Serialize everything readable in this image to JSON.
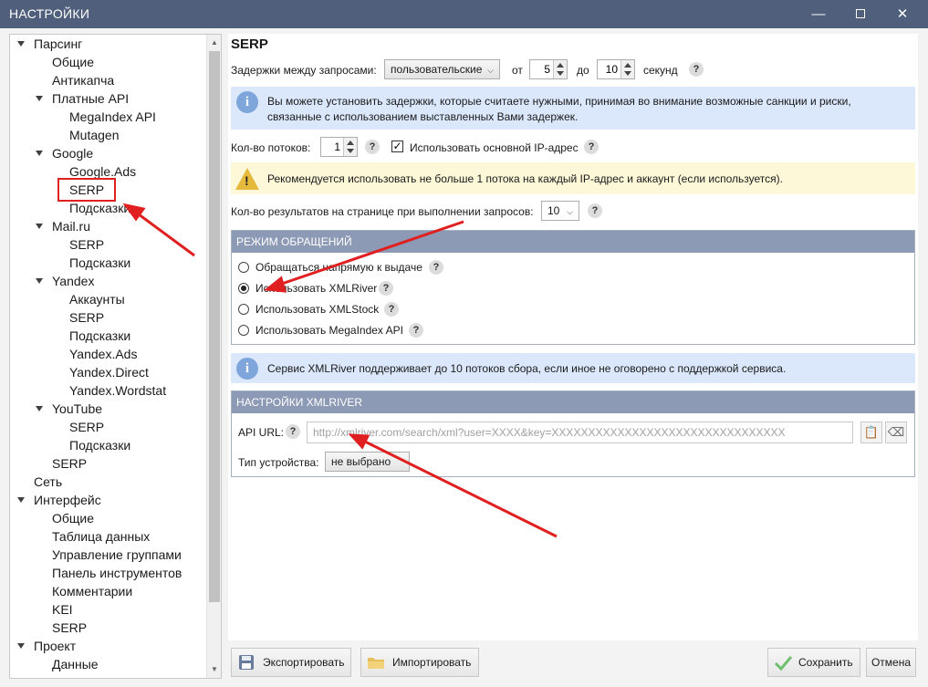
{
  "window": {
    "title": "НАСТРОЙКИ",
    "minimize": "—",
    "close": "✕"
  },
  "tree": {
    "items": [
      {
        "label": "Парсинг",
        "level": 0,
        "expandable": true
      },
      {
        "label": "Общие",
        "level": 1
      },
      {
        "label": "Антикапча",
        "level": 1
      },
      {
        "label": "Платные API",
        "level": 1,
        "expandable": true
      },
      {
        "label": "MegaIndex API",
        "level": 2
      },
      {
        "label": "Mutagen",
        "level": 2
      },
      {
        "label": "Google",
        "level": 1,
        "expandable": true
      },
      {
        "label": "Google.Ads",
        "level": 2
      },
      {
        "label": "SERP",
        "level": 2,
        "selected": true
      },
      {
        "label": "Подсказки",
        "level": 2
      },
      {
        "label": "Mail.ru",
        "level": 1,
        "expandable": true
      },
      {
        "label": "SERP",
        "level": 2
      },
      {
        "label": "Подсказки",
        "level": 2
      },
      {
        "label": "Yandex",
        "level": 1,
        "expandable": true
      },
      {
        "label": "Аккаунты",
        "level": 2
      },
      {
        "label": "SERP",
        "level": 2
      },
      {
        "label": "Подсказки",
        "level": 2
      },
      {
        "label": "Yandex.Ads",
        "level": 2
      },
      {
        "label": "Yandex.Direct",
        "level": 2
      },
      {
        "label": "Yandex.Wordstat",
        "level": 2
      },
      {
        "label": "YouTube",
        "level": 1,
        "expandable": true
      },
      {
        "label": "SERP",
        "level": 2
      },
      {
        "label": "Подсказки",
        "level": 2
      },
      {
        "label": "SERP",
        "level": 1
      },
      {
        "label": "Сеть",
        "level": 0
      },
      {
        "label": "Интерфейс",
        "level": 0,
        "expandable": true
      },
      {
        "label": "Общие",
        "level": 1
      },
      {
        "label": "Таблица данных",
        "level": 1
      },
      {
        "label": "Управление группами",
        "level": 1
      },
      {
        "label": "Панель инструментов",
        "level": 1
      },
      {
        "label": "Комментарии",
        "level": 1
      },
      {
        "label": "KEI",
        "level": 1
      },
      {
        "label": "SERP",
        "level": 1
      },
      {
        "label": "Проект",
        "level": 0,
        "expandable": true
      },
      {
        "label": "Данные",
        "level": 1
      }
    ]
  },
  "main": {
    "title": "SERP",
    "delay": {
      "label": "Задержки между запросами:",
      "mode": "пользовательские",
      "from_label": "от",
      "from_value": "5",
      "to_label": "до",
      "to_value": "10",
      "unit": "секунд"
    },
    "delay_info": "Вы можете установить задержки, которые считаете нужными, принимая во внимание возможные санкции и риски, связанные с использованием выставленных Вами задержек.",
    "threads": {
      "label": "Кол-во потоков:",
      "value": "1",
      "use_main_ip_label": "Использовать основной IP-адрес",
      "use_main_ip_checked": true
    },
    "threads_warning": "Рекомендуется использовать не больше 1 потока на каждый IP-адрес и аккаунт (если используется).",
    "results_per_page": {
      "label": "Кол-во результатов на странице при выполнении запросов:",
      "value": "10"
    },
    "mode_group": {
      "title": "Режим обращений",
      "options": [
        {
          "label": "Обращаться напрямую к выдаче",
          "selected": false
        },
        {
          "label": "Использовать XMLRiver",
          "selected": true
        },
        {
          "label": "Использовать XMLStock",
          "selected": false
        },
        {
          "label": "Использовать MegaIndex API",
          "selected": false
        }
      ]
    },
    "xmlriver_info": "Сервис XMLRiver поддерживает до 10 потоков сбора, если иное не оговорено с поддержкой сервиса.",
    "xmlriver_group": {
      "title": "Настройки XMLRiver",
      "api_url_label": "API URL:",
      "api_url_placeholder": "http://xmlriver.com/search/xml?user=XXXX&key=XXXXXXXXXXXXXXXXXXXXXXXXXXXXXXXX",
      "device_label": "Тип устройства:",
      "device_value": "не выбрано"
    }
  },
  "footer": {
    "export_label": "Экспортировать",
    "import_label": "Импортировать",
    "save_label": "Сохранить",
    "cancel_label": "Отмена"
  },
  "colors": {
    "titlebar": "#4f5f7c",
    "group_header": "#8d9ab6",
    "info_bg": "#dbe8fb",
    "warn_bg": "#fdf8d8",
    "annotation": "#e02020"
  }
}
